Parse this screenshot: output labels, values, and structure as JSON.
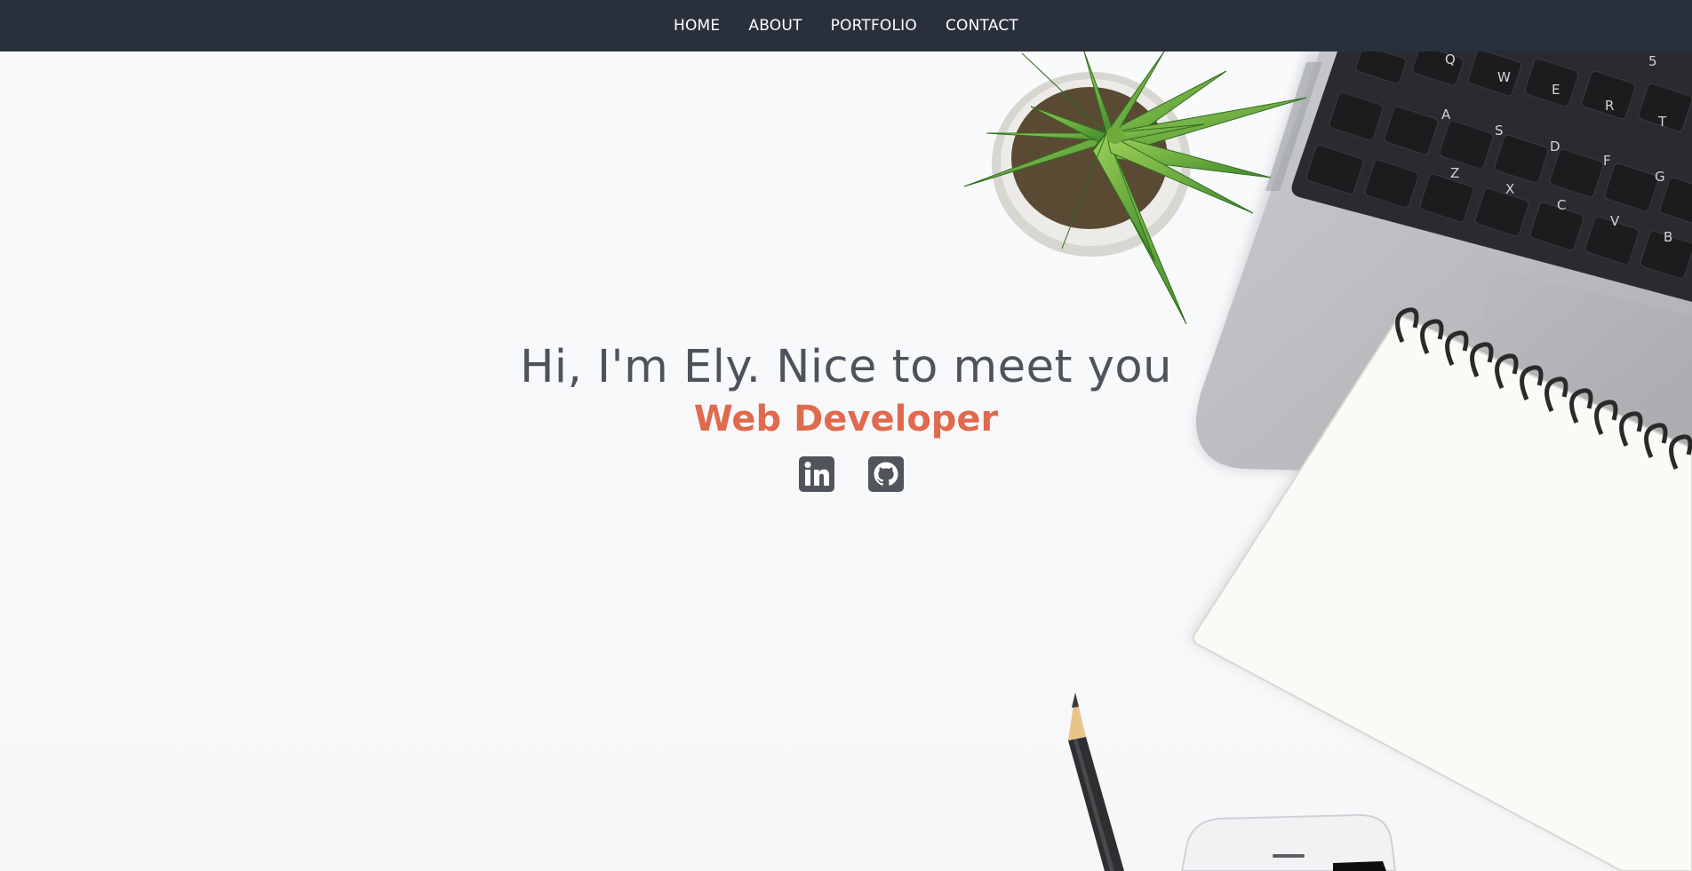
{
  "nav": {
    "items": [
      {
        "label": "HOME"
      },
      {
        "label": "ABOUT"
      },
      {
        "label": "PORTFOLIO"
      },
      {
        "label": "CONTACT"
      }
    ]
  },
  "hero": {
    "greeting": "Hi, I'm Ely. Nice to meet you",
    "role": "Web Developer"
  },
  "social": [
    {
      "icon": "linkedin-icon"
    },
    {
      "icon": "github-icon"
    }
  ],
  "keyboard": {
    "keys": [
      "Q",
      "W",
      "E",
      "R",
      "T",
      "5",
      "A",
      "S",
      "D",
      "F",
      "G",
      "Z",
      "X",
      "C",
      "V",
      "B"
    ]
  },
  "colors": {
    "navbar": "#29303c",
    "heading": "#4e535b",
    "accent": "#e06a4e",
    "icon": "#50545b"
  }
}
